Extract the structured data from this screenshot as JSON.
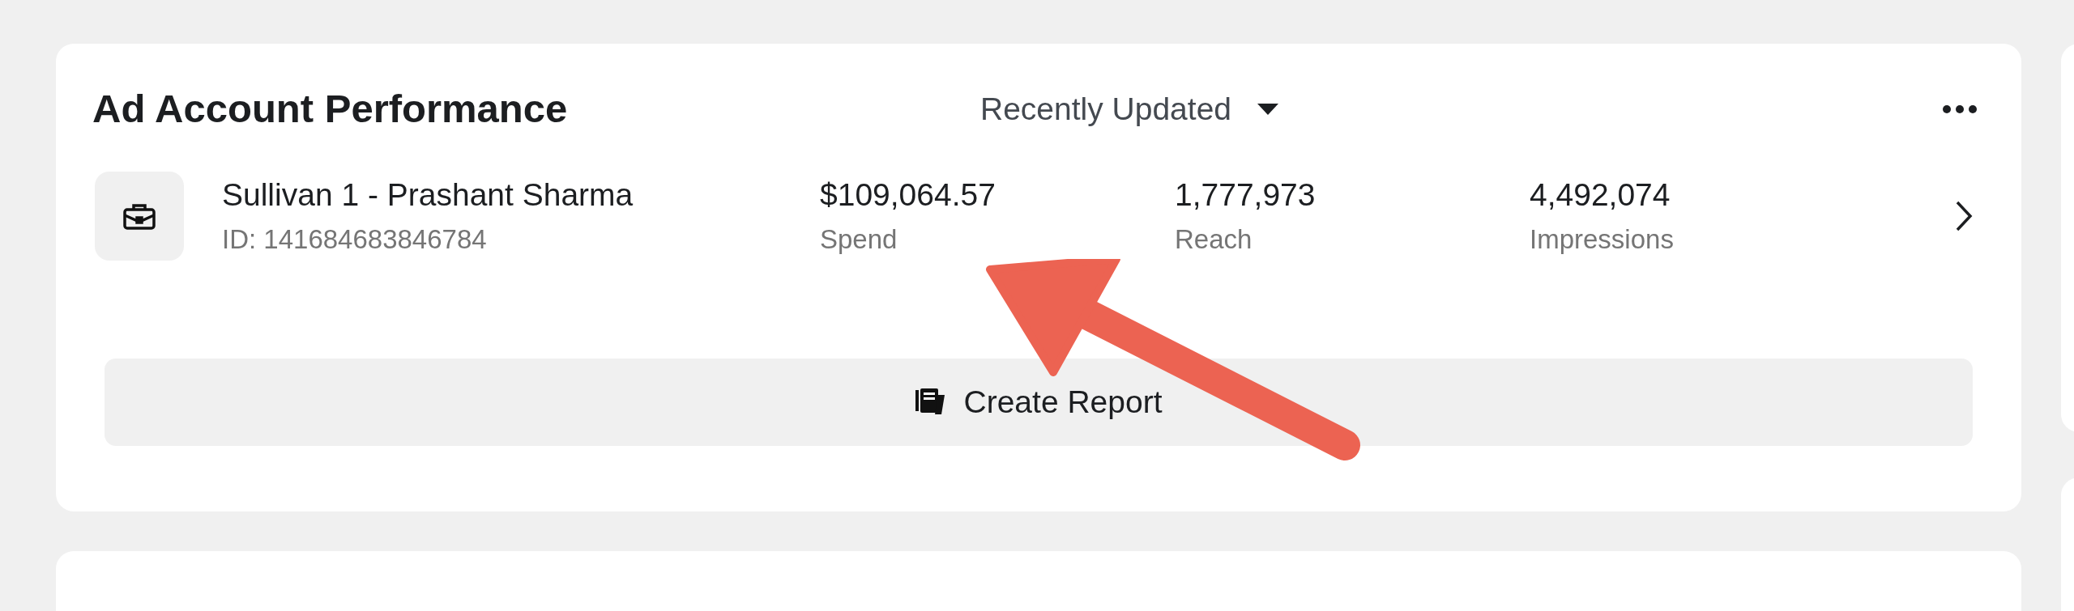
{
  "card": {
    "title": "Ad Account Performance",
    "sort": {
      "label": "Recently Updated"
    },
    "account": {
      "name": "Sullivan 1 - Prashant Sharma",
      "id": "ID: 141684683846784",
      "metrics": [
        {
          "value": "$109,064.57",
          "label": "Spend"
        },
        {
          "value": "1,777,973",
          "label": "Reach"
        },
        {
          "value": "4,492,074",
          "label": "Impressions"
        }
      ]
    },
    "button": {
      "label": "Create Report"
    }
  },
  "annotation": {
    "kind": "arrow"
  }
}
